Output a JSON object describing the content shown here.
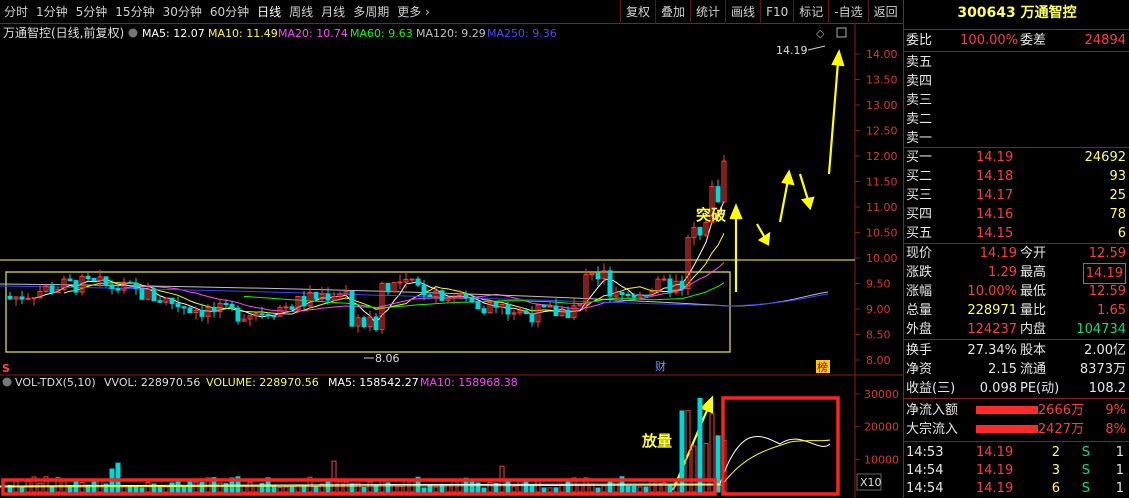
{
  "toolbar": {
    "periods": [
      "分时",
      "1分钟",
      "5分钟",
      "15分钟",
      "30分钟",
      "60分钟",
      "日线",
      "周线",
      "月线",
      "多周期",
      "更多"
    ],
    "active_index": 6,
    "buttons": [
      "复权",
      "叠加",
      "统计",
      "画线",
      "F10",
      "标记",
      "-自选",
      "返回"
    ]
  },
  "main_legend": {
    "title": "万通智控(日线,前复权)",
    "ma5": "MA5: 12.07",
    "ma10": "MA10: 11.49",
    "ma20": "MA20: 10.74",
    "ma60": "MA60: 9.63",
    "ma120": "MA120: 9.29",
    "ma250": "MA250: 9.36"
  },
  "vol_legend": {
    "name": "VOL-TDX(5,10)",
    "vvol": "VVOL: 228970.56",
    "volume": "VOLUME: 228970.56",
    "ma5": "MA5: 158542.27",
    "ma10": "MA10: 158968.38"
  },
  "annotations": {
    "breakout": "突破",
    "volume_up": "放量",
    "high_label": "14.19",
    "low_label": "8.06",
    "cai_marker": "财",
    "bang_marker": "榜",
    "s_marker": "S",
    "x10": "X10"
  },
  "axis": {
    "price_ticks": [
      "14.00",
      "13.50",
      "13.00",
      "12.50",
      "12.00",
      "11.50",
      "11.00",
      "10.50",
      "10.00",
      "9.50",
      "9.00",
      "8.50",
      "8.00"
    ],
    "volume_ticks": [
      "30000",
      "20000",
      "10000"
    ]
  },
  "colors": {
    "up": "#ff3b3b",
    "down": "#00d8d8",
    "ma5": "#ffffff",
    "ma10": "#ffff00",
    "ma20": "#ff44ff",
    "ma60": "#00ff00",
    "ma120": "#c0c0c0",
    "ma250": "#4040ff",
    "frame": "#8a1c1c"
  },
  "quote": {
    "code": "300643",
    "name": "万通智控",
    "weibi_label": "委比",
    "weibi_value": "100.00%",
    "weicha_label": "委差",
    "weicha_value": "24894",
    "sells": [
      {
        "label": "卖五",
        "price": "",
        "vol": ""
      },
      {
        "label": "卖四",
        "price": "",
        "vol": ""
      },
      {
        "label": "卖三",
        "price": "",
        "vol": ""
      },
      {
        "label": "卖二",
        "price": "",
        "vol": ""
      },
      {
        "label": "卖一",
        "price": "",
        "vol": ""
      }
    ],
    "buys": [
      {
        "label": "买一",
        "price": "14.19",
        "vol": "24692"
      },
      {
        "label": "买二",
        "price": "14.18",
        "vol": "93"
      },
      {
        "label": "买三",
        "price": "14.17",
        "vol": "25"
      },
      {
        "label": "买四",
        "price": "14.16",
        "vol": "78"
      },
      {
        "label": "买五",
        "price": "14.15",
        "vol": "6"
      }
    ],
    "stats": [
      {
        "l1": "现价",
        "v1": "14.19",
        "l2": "今开",
        "v2": "12.59",
        "c1": "red",
        "c2": "red"
      },
      {
        "l1": "涨跌",
        "v1": "1.29",
        "l2": "最高",
        "v2": "14.19",
        "c1": "red",
        "c2": "red"
      },
      {
        "l1": "涨幅",
        "v1": "10.00%",
        "l2": "最低",
        "v2": "12.59",
        "c1": "red",
        "c2": "red"
      },
      {
        "l1": "总量",
        "v1": "228971",
        "l2": "量比",
        "v2": "1.65",
        "c1": "yel",
        "c2": "red"
      },
      {
        "l1": "外盘",
        "v1": "124237",
        "l2": "内盘",
        "v2": "104734",
        "c1": "red",
        "c2": "green"
      }
    ],
    "stats2": [
      {
        "l1": "换手",
        "v1": "27.34%",
        "l2": "股本",
        "v2": "2.00亿"
      },
      {
        "l1": "净资",
        "v1": "2.15",
        "l2": "流通",
        "v2": "8373万"
      },
      {
        "l1": "收益(三)",
        "v1": "0.098",
        "l2": "PE(动)",
        "v2": "108.2"
      }
    ],
    "flows": [
      {
        "label": "净流入额",
        "value": "2666万",
        "pct": "9%"
      },
      {
        "label": "大宗流入",
        "value": "2427万",
        "pct": "8%"
      }
    ],
    "ticks": [
      {
        "time": "14:53",
        "price": "14.19",
        "vol": "2",
        "side": "S",
        "n": "1"
      },
      {
        "time": "14:54",
        "price": "14.19",
        "vol": "3",
        "side": "S",
        "n": "1"
      },
      {
        "time": "14:54",
        "price": "14.19",
        "vol": "6",
        "side": "S",
        "n": "1"
      }
    ]
  }
}
